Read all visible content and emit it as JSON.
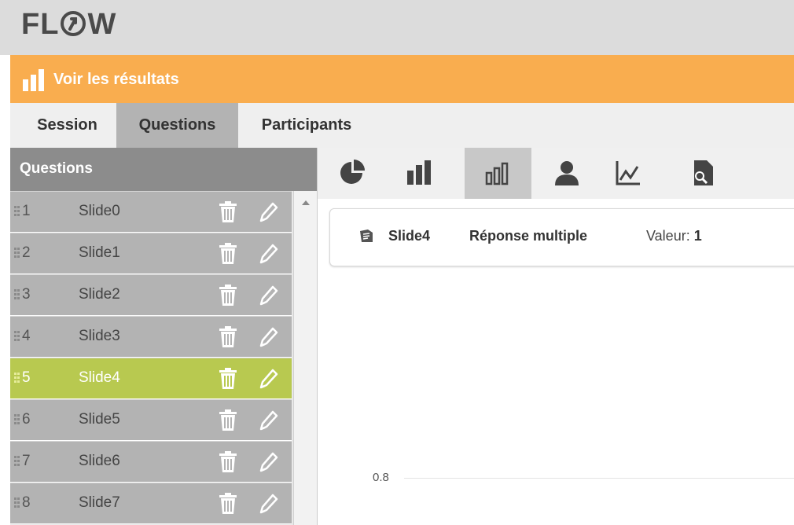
{
  "app": {
    "logo_prefix": "FL",
    "logo_suffix": "W",
    "results_label": "Voir les résultats"
  },
  "tabs": [
    {
      "label": "Session",
      "active": false
    },
    {
      "label": "Questions",
      "active": true
    },
    {
      "label": "Participants",
      "active": false
    }
  ],
  "questions_panel": {
    "header": "Questions",
    "items": [
      {
        "num": "1",
        "title": "Slide0",
        "selected": false
      },
      {
        "num": "2",
        "title": "Slide1",
        "selected": false
      },
      {
        "num": "3",
        "title": "Slide2",
        "selected": false
      },
      {
        "num": "4",
        "title": "Slide3",
        "selected": false
      },
      {
        "num": "5",
        "title": "Slide4",
        "selected": true
      },
      {
        "num": "6",
        "title": "Slide5",
        "selected": false
      },
      {
        "num": "7",
        "title": "Slide6",
        "selected": false
      },
      {
        "num": "8",
        "title": "Slide7",
        "selected": false
      }
    ],
    "selected_color": "#b8c950"
  },
  "toolbar": {
    "tools": [
      {
        "icon": "pie-chart-icon",
        "active": false
      },
      {
        "icon": "bar-chart-icon",
        "active": false
      },
      {
        "icon": "bar-chart-outline-icon",
        "active": true
      },
      {
        "icon": "user-icon",
        "active": false
      },
      {
        "icon": "line-chart-icon",
        "active": false
      },
      {
        "icon": "search-document-icon",
        "active": false
      }
    ]
  },
  "info": {
    "slide": "Slide4",
    "type": "Réponse multiple",
    "valeur_label": "Valeur:",
    "valeur_value": "1"
  },
  "chart": {
    "tick_label": "0.8"
  },
  "colors": {
    "accent_orange": "#f9ad4f",
    "selected_green": "#b8c950",
    "header_gray": "#8c8c8c"
  }
}
